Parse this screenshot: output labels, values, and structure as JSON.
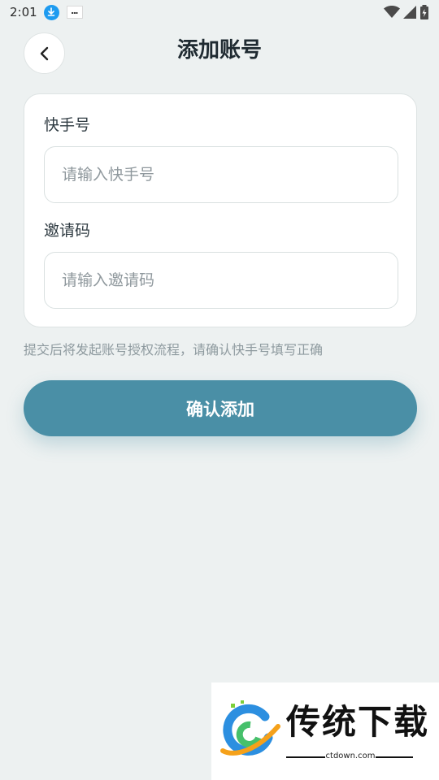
{
  "status_bar": {
    "time": "2:01",
    "icons": [
      "download-icon",
      "app-notification-icon",
      "wifi-icon",
      "signal-icon",
      "battery-icon"
    ]
  },
  "header": {
    "title": "添加账号",
    "back_icon": "chevron-left-icon"
  },
  "form": {
    "kuaishou": {
      "label": "快手号",
      "placeholder": "请输入快手号",
      "value": ""
    },
    "invite": {
      "label": "邀请码",
      "placeholder": "请输入邀请码",
      "value": ""
    }
  },
  "hint": "提交后将发起账号授权流程，请确认快手号填写正确",
  "confirm_button": {
    "label": "确认添加"
  },
  "watermark": {
    "title": "传统下载",
    "url": "ctdown.com"
  },
  "colors": {
    "background": "#edf1f1",
    "accent": "#4a8fa6",
    "card": "#ffffff",
    "hint": "#8e9a9f"
  }
}
